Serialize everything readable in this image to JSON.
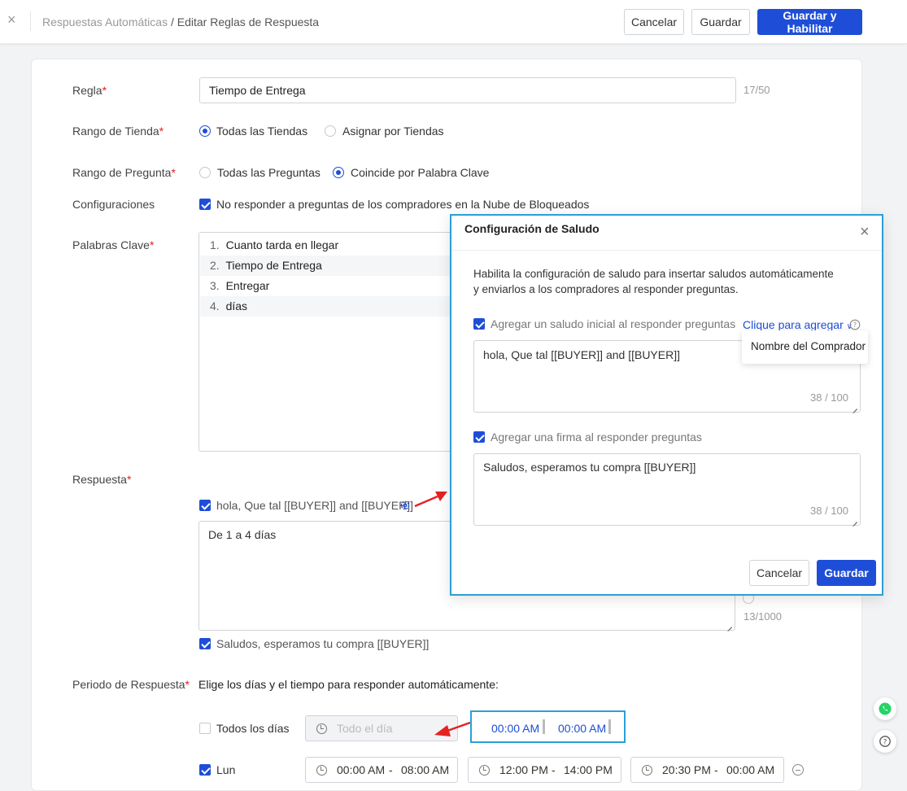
{
  "header": {
    "breadcrumb_parent": "Respuestas Automáticas",
    "breadcrumb_current": "/ Editar Reglas de Respuesta",
    "cancel_label": "Cancelar",
    "save_label": "Guardar",
    "save_enable_label": "Guardar y Habilitar"
  },
  "form": {
    "rule_label": "Regla",
    "rule_value": "Tiempo de Entrega",
    "rule_counter": "17/50",
    "store_range_label": "Rango de Tienda",
    "store_options": [
      "Todas las Tiendas",
      "Asignar por Tiendas"
    ],
    "store_selected": "Todas las Tiendas",
    "question_range_label": "Rango de Pregunta",
    "question_options": [
      "Todas las Preguntas",
      "Coincide por Palabra Clave"
    ],
    "question_selected": "Coincide por Palabra Clave",
    "settings_label": "Configuraciones",
    "settings_checkbox": "No responder a preguntas de los compradores en la Nube de Bloqueados",
    "keywords_label": "Palabras Clave",
    "keywords": [
      {
        "num": "1.",
        "text": "Cuanto tarda en llegar"
      },
      {
        "num": "2.",
        "text": "Tiempo de Entrega"
      },
      {
        "num": "3.",
        "text": "Entregar"
      },
      {
        "num": "4.",
        "text": "días"
      }
    ],
    "response_label": "Respuesta",
    "greeting_checkbox": "hola, Que tal [[BUYER]] and [[BUYER]]",
    "response_text": "De 1 a 4 días",
    "response_counter": "13/1000",
    "signature_checkbox": "Saludos, esperamos tu compra [[BUYER]]",
    "period_label": "Periodo de Respuesta",
    "period_hint": "Elige los días y el tiempo para responder automáticamente:",
    "all_days_label": "Todos los días",
    "all_day_placeholder": "Todo el día",
    "all_days_start": "00:00 AM",
    "all_days_end": "00:00 AM",
    "mon_label": "Lun",
    "mon_ranges": [
      {
        "start": "00:00 AM",
        "sep": "-",
        "end": "08:00 AM"
      },
      {
        "start": "12:00 PM",
        "sep": "-",
        "end": "14:00 PM"
      },
      {
        "start": "20:30 PM",
        "sep": "-",
        "end": "00:00 AM"
      }
    ]
  },
  "modal": {
    "title": "Configuración de Saludo",
    "description": "Habilita la configuración de saludo para insertar saludos automáticamente y enviarlos a los compradores al responder preguntas.",
    "greeting_checkbox": "Agregar un saludo inicial al responder preguntas",
    "insert_link": "Clique para agregar",
    "dropdown_option": "Nombre del Comprador",
    "greeting_text": "hola, Que tal [[BUYER]] and  [[BUYER]]",
    "greeting_counter": "38 / 100",
    "signature_checkbox": "Agregar una firma al responder preguntas",
    "signature_text": "Saludos, esperamos tu compra [[BUYER]]",
    "signature_counter": "38 / 100",
    "cancel_label": "Cancelar",
    "save_label": "Guardar"
  },
  "colors": {
    "primary": "#1e4ed8",
    "highlight": "#2a9fd8",
    "required": "#e02020",
    "arrow": "#e52222",
    "whatsapp": "#25d366"
  }
}
